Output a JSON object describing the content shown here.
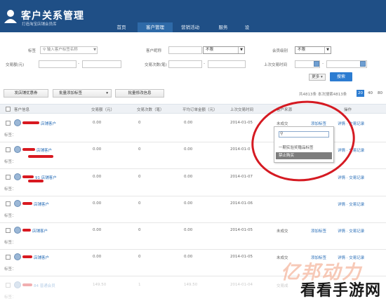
{
  "header": {
    "title": "客户关系管理",
    "subtitle": "打造淘宝店铺会员库",
    "nav": [
      {
        "label": "首页"
      },
      {
        "label": "客户管理",
        "active": true
      },
      {
        "label": "营销活动"
      },
      {
        "label": "服务"
      },
      {
        "label": "设"
      }
    ]
  },
  "filters": {
    "tag_label": "标签",
    "tag_placeholder": "输入客户标签名称",
    "customer_name_label": "客户昵称",
    "customer_name_value": "",
    "match_select": "不限",
    "member_level_label": "会员级别",
    "member_level_select": "不限",
    "trade_amount_label": "交易额(元)",
    "trade_count_label": "交易次数(笔)",
    "last_trade_time_label": "上次交易时间",
    "range_sep": "-",
    "more_label": "更多",
    "search_label": "搜索"
  },
  "toolbar": {
    "send_coupon": "发店铺优惠券",
    "batch_add_tag": "批量添加标签",
    "batch_edit_info": "批量修改信息",
    "summary": "共4813条 本次搜索4813条",
    "page_sizes": [
      "20",
      "40",
      "80"
    ],
    "active_page_size": "20"
  },
  "table": {
    "headers": [
      "客户信息",
      "交易额（元）",
      "交易次数（笔）",
      "平均订单金额（元）",
      "上次交易时间",
      "客户来源",
      "操作"
    ],
    "tag_label": "标签：",
    "rows": [
      {
        "name": "店铺客户",
        "amount": "0.00",
        "count": "0",
        "avg": "0.00",
        "last": "2014-01-05",
        "source": "未成交",
        "add_tag": "添加标签",
        "ops": "详情 · 交易记录"
      },
      {
        "name": "店铺客户",
        "amount": "0.00",
        "count": "0",
        "avg": "0.00",
        "last": "2014-01-0",
        "source": "",
        "add_tag": "",
        "ops": "详情 · 交易记录"
      },
      {
        "name": "91 店铺客户",
        "amount": "0.00",
        "count": "0",
        "avg": "0.00",
        "last": "2014-01-07",
        "source": "",
        "add_tag": "",
        "ops": "详情 · 交易记录"
      },
      {
        "name": "店铺客户",
        "amount": "0.00",
        "count": "0",
        "avg": "0.00",
        "last": "2014-01-06",
        "source": "",
        "add_tag": "",
        "ops": "详情 · 交易记录"
      },
      {
        "name": "店铺客户",
        "amount": "0.00",
        "count": "0",
        "avg": "0.00",
        "last": "2014-01-05",
        "source": "未成交",
        "add_tag": "添加标签",
        "ops": "详情 · 交易记录"
      },
      {
        "name": "店铺客户",
        "amount": "0.00",
        "count": "0",
        "avg": "0.00",
        "last": "2014-01-05",
        "source": "未成交",
        "add_tag": "添加标签",
        "ops": "详情 · 交易记录"
      },
      {
        "name": "84 普通会员",
        "amount": "149.50",
        "count": "1",
        "avg": "149.50",
        "last": "2014-01-04",
        "source": "交易成",
        "add_tag": "",
        "ops": ""
      }
    ]
  },
  "popup": {
    "items": [
      "一期实验奖赠品标签",
      "禁止购买"
    ]
  },
  "watermark": {
    "top": "亿邦动力",
    "bottom": "看看手游网"
  },
  "colors": {
    "header_bg": "#1f4f86",
    "accent": "#2c7cd1",
    "annotation": "#d51a22"
  }
}
